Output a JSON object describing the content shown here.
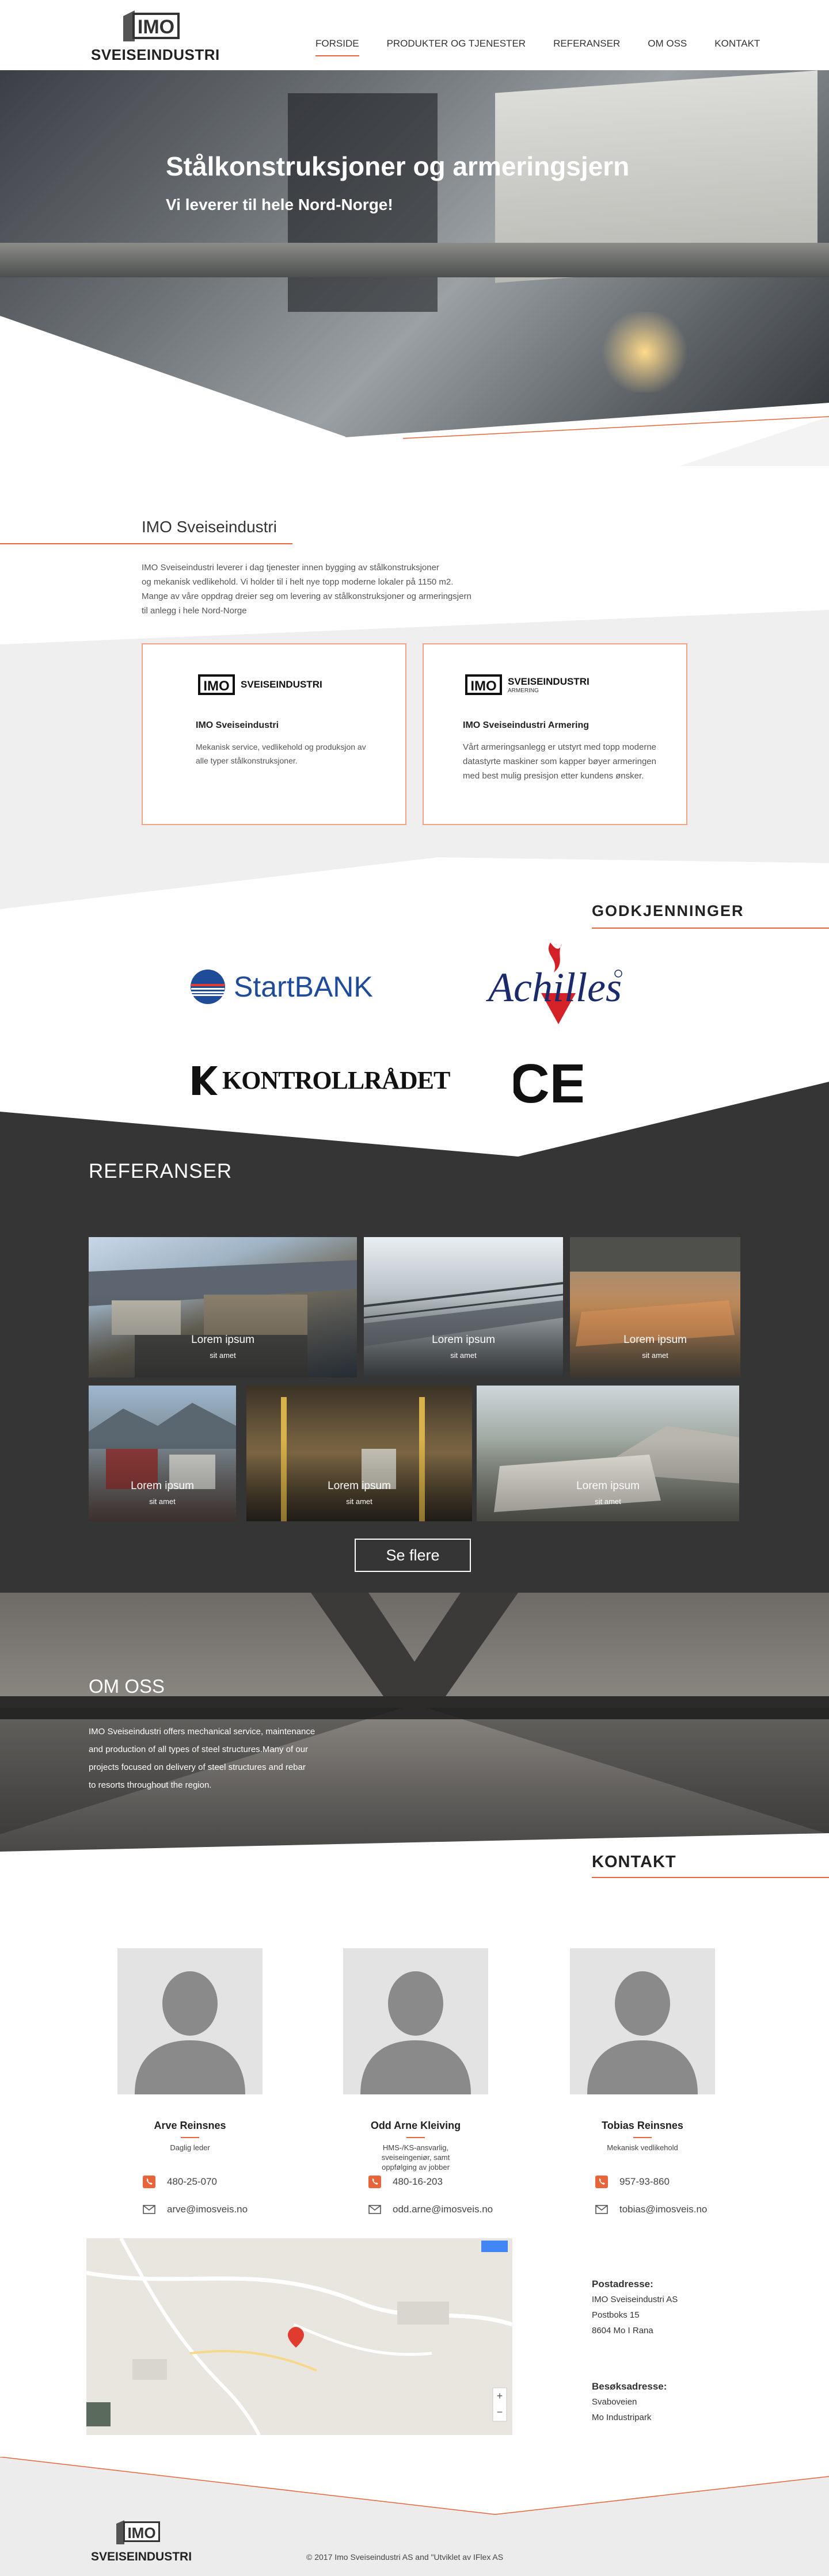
{
  "brand": {
    "logo_text": "SVEISEINDUSTRI",
    "accent_color": "#e8643a",
    "dark_color": "#353535"
  },
  "nav": {
    "items": [
      {
        "label": "FORSIDE",
        "active": true
      },
      {
        "label": "PRODUKTER OG TJENESTER"
      },
      {
        "label": "REFERANSER"
      },
      {
        "label": "OM OSS"
      },
      {
        "label": "KONTAKT"
      }
    ]
  },
  "hero": {
    "title": "Stålkonstruksjoner og armeringsjern",
    "subtitle": "Vi leverer til hele Nord-Norge!"
  },
  "about": {
    "title": "IMO Sveiseindustri",
    "lines": [
      "IMO Sveiseindustri leverer i dag tjenester innen bygging av stålkonstruksjoner",
      "og mekanisk vedlikehold. Vi holder til i helt nye topp moderne lokaler på 1150 m2.",
      "Mange av våre oppdrag dreier seg om levering av stålkonstruksjoner og armeringsjern",
      "til anlegg i hele Nord-Norge"
    ],
    "cards": [
      {
        "logo_text": "SVEISEINDUSTRI",
        "title": "IMO Sveiseindustri",
        "text": "Mekanisk service, vedlikehold og produksjon av alle typer stålkonstruksjoner."
      },
      {
        "logo_text": "SVEISEINDUSTRI",
        "logo_sub": "ARMERING",
        "title": "IMO Sveiseindustri Armering",
        "text": "Vårt armeringsanlegg er utstyrt med topp moderne datastyrte maskiner som kapper bøyer armeringen med best mulig presisjon etter kundens ønsker."
      }
    ]
  },
  "approvals": {
    "title": "GODKJENNINGER",
    "logos": {
      "startbank": "StartBANK",
      "achilles": "Achilles",
      "kontroll": "KONTROLLRÅDET",
      "ce": "CE"
    }
  },
  "references": {
    "title": "REFERANSER",
    "tiles": [
      {
        "title": "Lorem ipsum",
        "sub": "sit amet"
      },
      {
        "title": "Lorem ipsum",
        "sub": "sit amet"
      },
      {
        "title": "Lorem ipsum",
        "sub": "sit amet"
      },
      {
        "title": "Lorem ipsum",
        "sub": "sit amet"
      },
      {
        "title": "Lorem ipsum",
        "sub": "sit amet"
      },
      {
        "title": "Lorem ipsum",
        "sub": "sit amet"
      }
    ],
    "see_more": "Se flere"
  },
  "omoss": {
    "title": "OM OSS",
    "lines": [
      "IMO Sveiseindustri offers mechanical service, maintenance",
      "and production of all types of steel structures.Many of our",
      "projects focused on delivery of steel structures and rebar",
      "to resorts throughout the region."
    ]
  },
  "contact": {
    "title": "KONTAKT",
    "people": [
      {
        "name": "Arve Reinsnes",
        "role": "Daglig leder",
        "phone": "480-25-070",
        "email": "arve@imosveis.no"
      },
      {
        "name": "Odd Arne Kleiving",
        "role": "HMS-/KS-ansvarlig, sveiseingeniør, samt oppfølging av jobber",
        "phone": "480-16-203",
        "email": "odd.arne@imosveis.no"
      },
      {
        "name": "Tobias Reinsnes",
        "role": "Mekanisk vedlikehold",
        "phone": "957-93-860",
        "email": "tobias@imosveis.no"
      }
    ],
    "postal": {
      "label": "Postadresse:",
      "lines": [
        "IMO Sveiseindustri AS",
        "Postboks 15",
        "8604 Mo I Rana"
      ]
    },
    "visit": {
      "label": "Besøksadresse:",
      "lines": [
        "Svaboveien",
        "Mo Industripark"
      ]
    }
  },
  "footer": {
    "logo_text": "SVEISEINDUSTRI",
    "copyright": "© 2017 Imo Sveiseindustri AS and \"Utviklet av IFlex AS"
  }
}
